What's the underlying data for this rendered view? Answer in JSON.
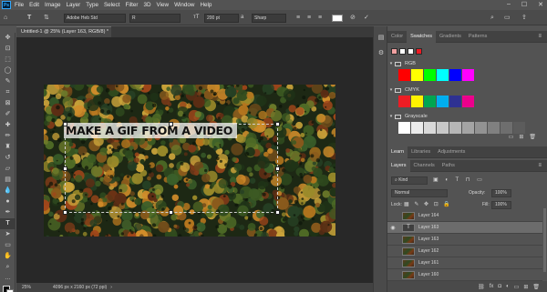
{
  "menu": {
    "logo": "Ps",
    "items": [
      "File",
      "Edit",
      "Image",
      "Layer",
      "Type",
      "Select",
      "Filter",
      "3D",
      "View",
      "Window",
      "Help"
    ],
    "window_controls": [
      "–",
      "☐",
      "✕"
    ]
  },
  "options_bar": {
    "font_family": "Adobe Heb Std",
    "font_style": "R",
    "font_size": "200 pt",
    "antialias_label": "a",
    "antialias": "Sharp"
  },
  "document": {
    "tab_title": "Untitled-1 @ 25% (Layer 163, RGB/8) *",
    "tab_close": "×",
    "overlay_text": "MAKE A GIF FROM A VIDEO"
  },
  "status": {
    "zoom": "25%",
    "doc_size": "4096 px x 2160 px (72 ppi)"
  },
  "swatches_panel": {
    "tabs": [
      "Color",
      "Swatches",
      "Gradients",
      "Patterns"
    ],
    "active_tab": "Swatches",
    "recent": [
      "#f0a0a0",
      "#ffffff",
      "#ffffff",
      "#ed1c24"
    ],
    "groups": [
      {
        "name": "RGB",
        "colors": [
          "#ff0000",
          "#ffff00",
          "#00ff00",
          "#00ffff",
          "#0000ff",
          "#ff00ff"
        ]
      },
      {
        "name": "CMYK",
        "colors": [
          "#ed1c24",
          "#fff200",
          "#00a651",
          "#00aeef",
          "#2e3192",
          "#ec008c"
        ]
      },
      {
        "name": "Grayscale",
        "colors": [
          "#ffffff",
          "#ebebeb",
          "#d9d9d9",
          "#c8c8c8",
          "#b6b6b6",
          "#a4a4a4",
          "#929292",
          "#808080",
          "#6e6e6e",
          "#5c5c5c"
        ]
      }
    ]
  },
  "learn_panel": {
    "tabs": [
      "Learn",
      "Libraries",
      "Adjustments"
    ],
    "active_tab": "Learn"
  },
  "layers_panel": {
    "tabs": [
      "Layers",
      "Channels",
      "Paths"
    ],
    "active_tab": "Layers",
    "filter": "Kind",
    "blend_mode": "Normal",
    "opacity_label": "Opacity:",
    "opacity": "100%",
    "lock_label": "Lock:",
    "fill_label": "Fill:",
    "fill": "100%",
    "layers": [
      {
        "name": "Layer 164",
        "type": "image",
        "visible": false,
        "selected": false
      },
      {
        "name": "Layer 163",
        "type": "text",
        "visible": true,
        "selected": true
      },
      {
        "name": "Layer 163",
        "type": "image",
        "visible": false,
        "selected": false
      },
      {
        "name": "Layer 162",
        "type": "image",
        "visible": false,
        "selected": false
      },
      {
        "name": "Layer 161",
        "type": "image",
        "visible": false,
        "selected": false
      },
      {
        "name": "Layer 160",
        "type": "image",
        "visible": false,
        "selected": false
      }
    ]
  },
  "icons": {
    "tools": [
      "move-icon",
      "artboard-icon",
      "marquee-icon",
      "lasso-icon",
      "quick-select-icon",
      "crop-icon",
      "frame-icon",
      "eyedropper-icon",
      "healing-icon",
      "brush-icon",
      "clone-stamp-icon",
      "history-brush-icon",
      "eraser-icon",
      "gradient-icon",
      "blur-icon",
      "dodge-icon",
      "pen-icon",
      "type-icon",
      "path-select-icon",
      "rectangle-icon",
      "hand-icon",
      "zoom-icon"
    ]
  }
}
